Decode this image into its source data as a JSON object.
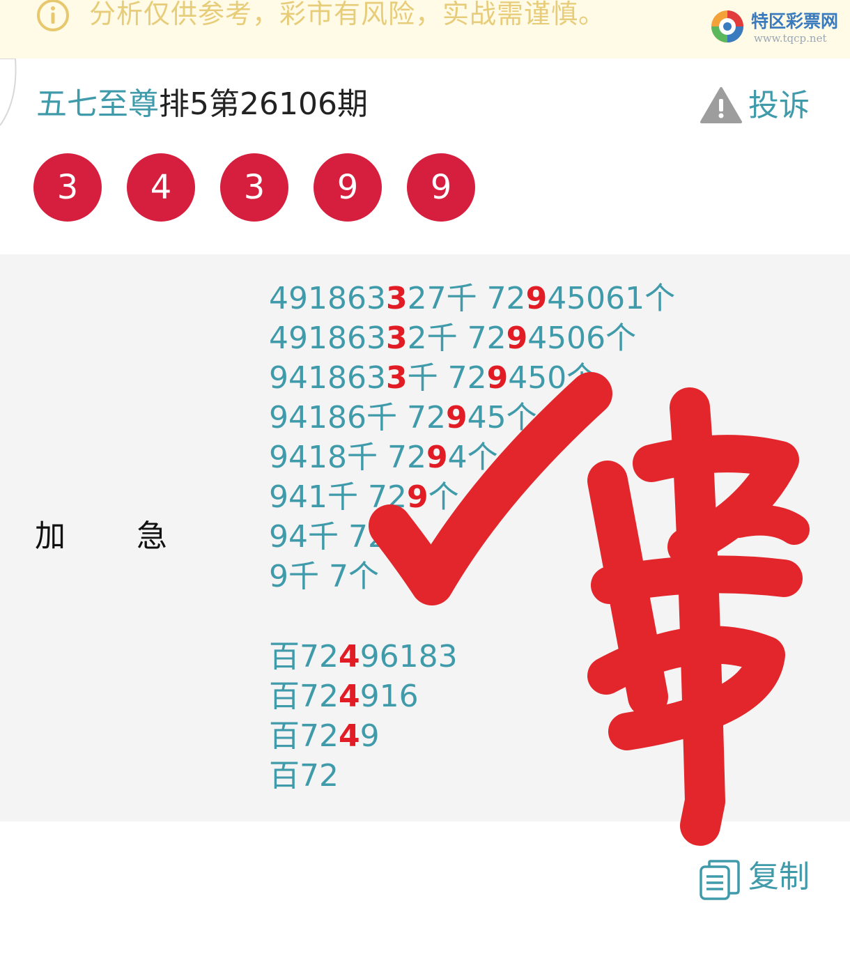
{
  "notice": {
    "icon": "info-circle-icon",
    "text": "分析仅供参考，彩市有风险，实战需谨慎。"
  },
  "watermark": {
    "name": "特区彩票网",
    "url": "www.tqcp.net"
  },
  "post": {
    "author": "五七至尊",
    "title_rest": "排5第26106期",
    "complain_label": "投诉",
    "balls": [
      "3",
      "4",
      "3",
      "9",
      "9"
    ]
  },
  "content": {
    "label_left": "加",
    "label_right": "急",
    "lines": [
      {
        "pre": "491863",
        "hl": "3",
        "post": "27千 72",
        "hl2": "9",
        "post2": "45061个"
      },
      {
        "pre": "491863",
        "hl": "3",
        "post": "2千 72",
        "hl2": "9",
        "post2": "4506个"
      },
      {
        "pre": "941863",
        "hl": "3",
        "post": "千 72",
        "hl2": "9",
        "post2": "450个"
      },
      {
        "pre": "94186千 72",
        "hl": "9",
        "post": "45个",
        "hl2": "",
        "post2": ""
      },
      {
        "pre": "9418千 72",
        "hl": "9",
        "post": "4个",
        "hl2": "",
        "post2": ""
      },
      {
        "pre": "941千 72",
        "hl": "9",
        "post": "个",
        "hl2": "",
        "post2": ""
      },
      {
        "pre": "94千 72",
        "hl": "",
        "post": "",
        "hl2": "",
        "post2": ""
      },
      {
        "pre": "9千 7个",
        "hl": "",
        "post": "",
        "hl2": "",
        "post2": ""
      }
    ],
    "lines2": [
      {
        "pre": "百72",
        "hl": "4",
        "post": "96183"
      },
      {
        "pre": "百72",
        "hl": "4",
        "post": "916"
      },
      {
        "pre": "百72",
        "hl": "4",
        "post": "9"
      },
      {
        "pre": "百72",
        "hl": "",
        "post": ""
      }
    ]
  },
  "annotation": {
    "check_mark": "red-check-mark",
    "handwritten": "准",
    "color": "#e3262b"
  },
  "copy_label": "复制",
  "colors": {
    "accent": "#3f9aaa",
    "ball": "#d61f3e",
    "highlight": "#e21c24",
    "notice_bg": "#fffbe6"
  }
}
